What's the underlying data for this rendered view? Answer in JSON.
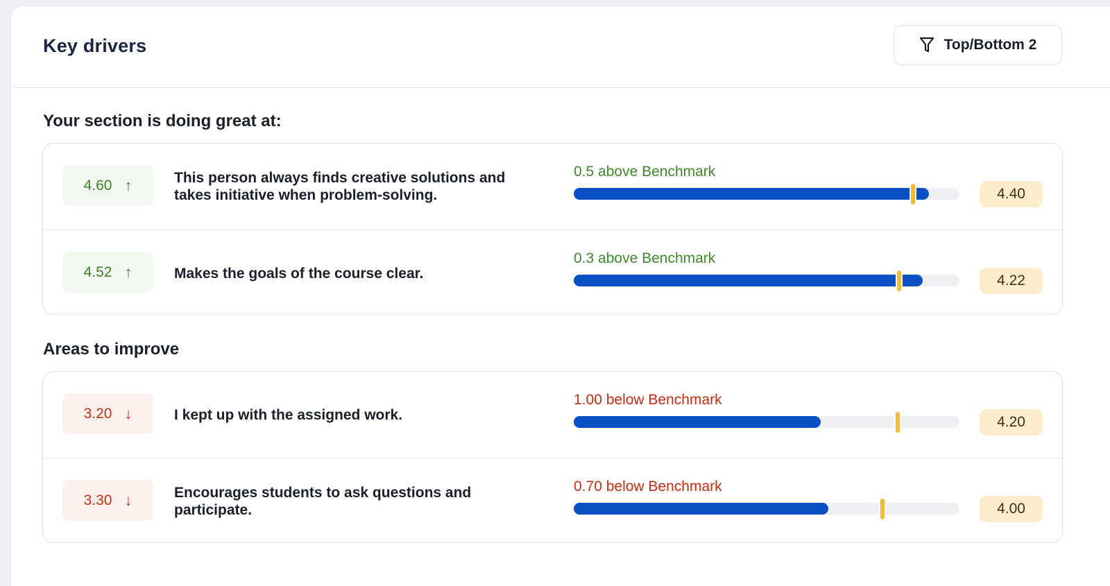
{
  "header": {
    "title": "Key drivers",
    "filter_label": "Top/Bottom 2"
  },
  "colors": {
    "accent_bar": "#0a4fc4",
    "benchmark_marker": "#f4bb35",
    "positive": "#3e8a2a",
    "negative": "#c82d10"
  },
  "strengths": {
    "title": "Your section is doing great at:",
    "items": [
      {
        "score": "4.60",
        "direction": "up",
        "statement": "This person always finds creative solutions and takes initiative when problem-solving.",
        "delta_text": "0.5 above Benchmark",
        "benchmark": "4.40",
        "score_fraction": 0.92,
        "benchmark_fraction": 0.88
      },
      {
        "score": "4.52",
        "direction": "up",
        "statement": "Makes the goals of the course clear.",
        "delta_text": "0.3 above Benchmark",
        "benchmark": "4.22",
        "score_fraction": 0.904,
        "benchmark_fraction": 0.844
      }
    ]
  },
  "improvements": {
    "title": "Areas to improve",
    "items": [
      {
        "score": "3.20",
        "direction": "down",
        "statement": "I kept up with the assigned work.",
        "delta_text": "1.00 below Benchmark",
        "benchmark": "4.20",
        "score_fraction": 0.64,
        "benchmark_fraction": 0.84
      },
      {
        "score": "3.30",
        "direction": "down",
        "statement": "Encourages students to ask questions and participate.",
        "delta_text": "0.70 below Benchmark",
        "benchmark": "4.00",
        "score_fraction": 0.66,
        "benchmark_fraction": 0.8
      }
    ]
  }
}
